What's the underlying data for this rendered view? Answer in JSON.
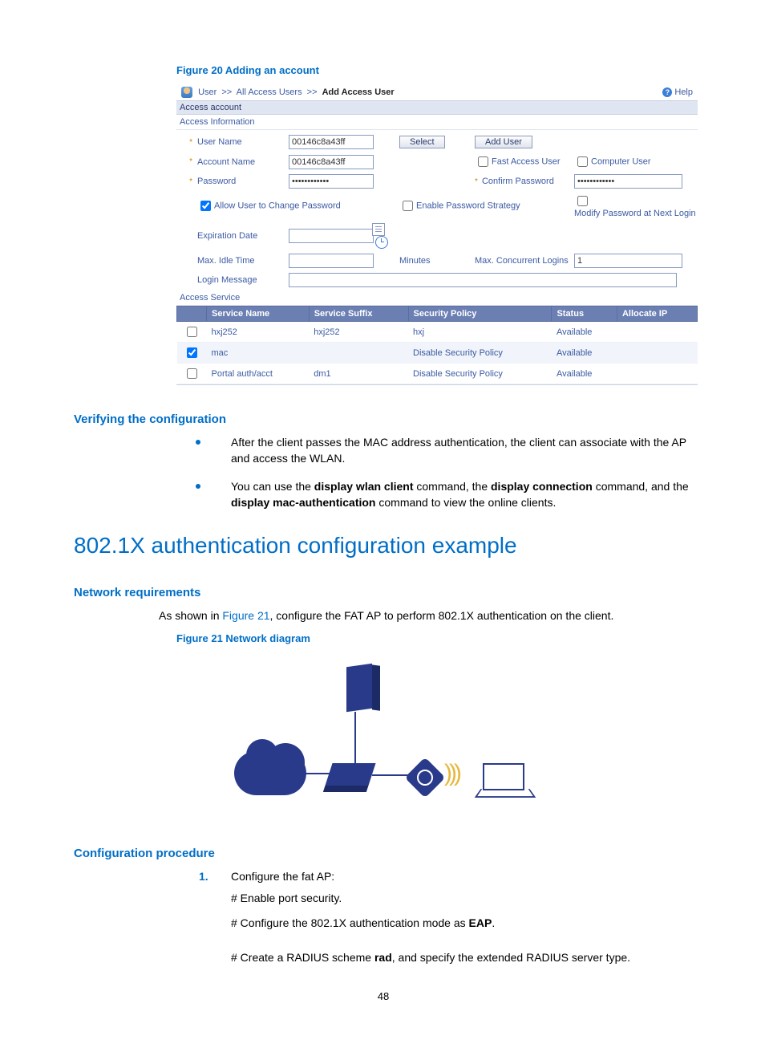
{
  "figure20_caption": "Figure 20 Adding an account",
  "breadcrumb": {
    "root": "User",
    "mid": "All Access Users",
    "leaf": "Add Access User",
    "help": "Help"
  },
  "panel": {
    "title": "Access account",
    "info": "Access Information",
    "service_title": "Access Service"
  },
  "form": {
    "user_name": {
      "label": "User Name",
      "value": "00146c8a43ff"
    },
    "select_btn": "Select",
    "add_user_btn": "Add User",
    "account_name": {
      "label": "Account Name",
      "value": "00146c8a43ff"
    },
    "fast_access": {
      "label": "Fast Access User"
    },
    "computer_user": {
      "label": "Computer User"
    },
    "password": {
      "label": "Password",
      "value": "************"
    },
    "confirm_password": {
      "label": "Confirm Password",
      "value": "************"
    },
    "allow_change": {
      "label": "Allow User to Change Password"
    },
    "enable_strategy": {
      "label": "Enable Password Strategy"
    },
    "modify_next": {
      "label": "Modify Password at Next Login"
    },
    "expiration": {
      "label": "Expiration Date"
    },
    "idle": {
      "label": "Max. Idle Time",
      "unit": "Minutes"
    },
    "concurrent": {
      "label": "Max. Concurrent Logins",
      "value": "1"
    },
    "login_msg": {
      "label": "Login Message"
    }
  },
  "svc_headers": {
    "name": "Service Name",
    "suffix": "Service Suffix",
    "policy": "Security Policy",
    "status": "Status",
    "alloc": "Allocate IP"
  },
  "svc_rows": [
    {
      "name": "hxj252",
      "suffix": "hxj252",
      "policy": "hxj",
      "status": "Available"
    },
    {
      "name": "mac",
      "suffix": "",
      "policy": "Disable Security Policy",
      "status": "Available"
    },
    {
      "name": "Portal auth/acct",
      "suffix": "dm1",
      "policy": "Disable Security Policy",
      "status": "Available"
    }
  ],
  "verify_title": "Verifying the configuration",
  "verify_b1": "After the client passes the MAC address authentication, the client can associate with the AP and access the WLAN.",
  "verify_b2_a": "You can use the ",
  "verify_b2_b": "display wlan client",
  "verify_b2_c": " command, the ",
  "verify_b2_d": "display connection",
  "verify_b2_e": " command, and the ",
  "verify_b2_f": "display mac-authentication",
  "verify_b2_g": " command to view the online clients.",
  "main_title": "802.1X authentication configuration example",
  "netreq_title": "Network requirements",
  "netreq_a": "As shown in ",
  "netreq_link": "Figure 21",
  "netreq_b": ", configure the FAT AP to perform 802.1X authentication on the client.",
  "figure21_caption": "Figure 21 Network diagram",
  "config_title": "Configuration procedure",
  "step1": "Configure the fat AP:",
  "step1a": "# Enable port security.",
  "step1b_a": "# Configure the 802.1X authentication mode as ",
  "step1b_b": "EAP",
  "step1b_c": ".",
  "step1c_a": "# Create a RADIUS scheme ",
  "step1c_b": "rad",
  "step1c_c": ", and specify the extended RADIUS server type.",
  "page_number": "48"
}
